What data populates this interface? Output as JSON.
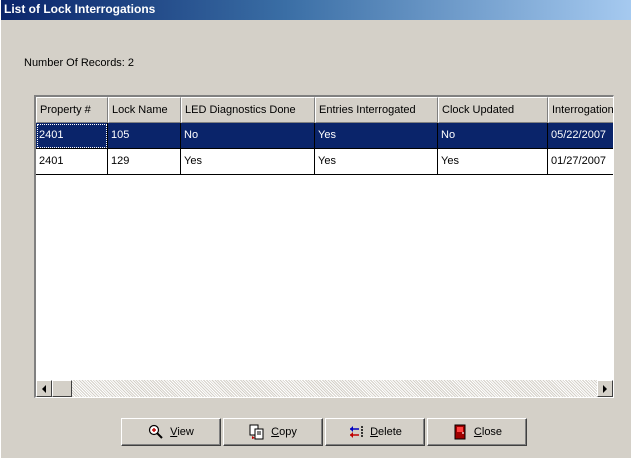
{
  "window": {
    "title": "List of Lock Interrogations"
  },
  "summary": {
    "record_count_text": "Number Of Records: 2"
  },
  "grid": {
    "columns": [
      "Property #",
      "Lock Name",
      "LED Diagnostics Done",
      "Entries Interrogated",
      "Clock Updated",
      "Interrogation"
    ],
    "rows": [
      {
        "cells": [
          "2401",
          "105",
          "No",
          "Yes",
          "No",
          "05/22/2007"
        ],
        "selected": true
      },
      {
        "cells": [
          "2401",
          "129",
          "Yes",
          "Yes",
          "Yes",
          "01/27/2007"
        ],
        "selected": false
      }
    ],
    "selection_color": "#0a246a"
  },
  "buttons": {
    "view": {
      "label": "View",
      "icon": "magnify-plus-icon"
    },
    "copy": {
      "label": "Copy",
      "icon": "copy-doc-icon"
    },
    "delete": {
      "label": "Delete",
      "icon": "delete-arrows-icon"
    },
    "close": {
      "label": "Close",
      "icon": "close-door-icon"
    }
  }
}
